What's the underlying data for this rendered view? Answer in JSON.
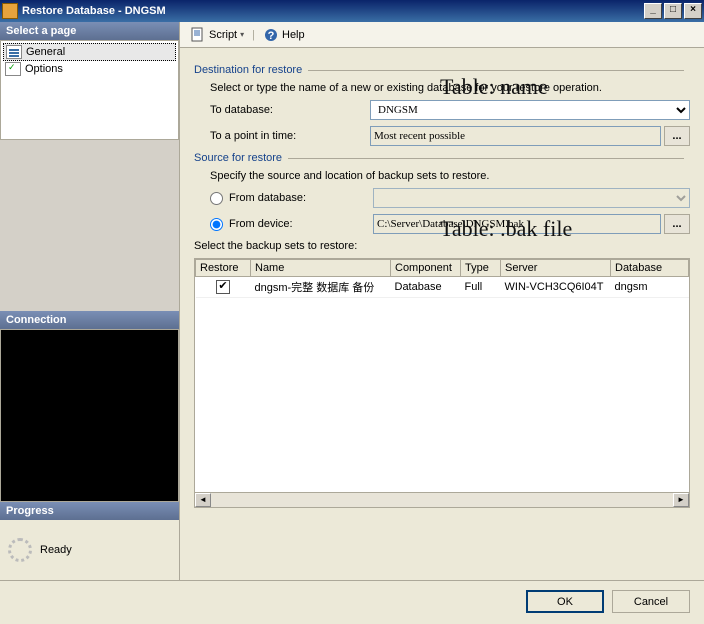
{
  "window": {
    "title": "Restore Database - DNGSM"
  },
  "win_buttons": {
    "min": "_",
    "max": "□",
    "close": "×"
  },
  "sidebar": {
    "pages_header": "Select a page",
    "pages": [
      {
        "label": "General",
        "selected": true
      },
      {
        "label": "Options",
        "selected": false
      }
    ],
    "connection_header": "Connection",
    "progress_header": "Progress",
    "progress_status": "Ready"
  },
  "toolbar": {
    "script": "Script",
    "help": "Help"
  },
  "form": {
    "dest_section": "Destination for restore",
    "dest_hint": "Select or type the name of a new or existing database for your restore operation.",
    "to_db_label": "To database:",
    "to_db_value": "DNGSM",
    "to_point_label": "To a point in time:",
    "to_point_value": "Most recent possible",
    "src_section": "Source for restore",
    "src_hint": "Specify the source and location of backup sets to restore.",
    "from_db_label": "From database:",
    "from_db_value": "",
    "from_device_label": "From device:",
    "from_device_value": "C:\\Server\\Database\\DNGSM.bak",
    "sets_label": "Select the backup sets to restore:"
  },
  "table": {
    "headers": {
      "restore": "Restore",
      "name": "Name",
      "component": "Component",
      "type": "Type",
      "server": "Server",
      "database": "Database"
    },
    "rows": [
      {
        "restore": true,
        "name": "dngsm-完整 数据库 备份",
        "component": "Database",
        "type": "Full",
        "server": "WIN-VCH3CQ6I04T",
        "database": "dngsm"
      }
    ]
  },
  "footer": {
    "ok": "OK",
    "cancel": "Cancel"
  },
  "annotations": {
    "a1": "Table: name",
    "a2": "Table: .bak file"
  }
}
